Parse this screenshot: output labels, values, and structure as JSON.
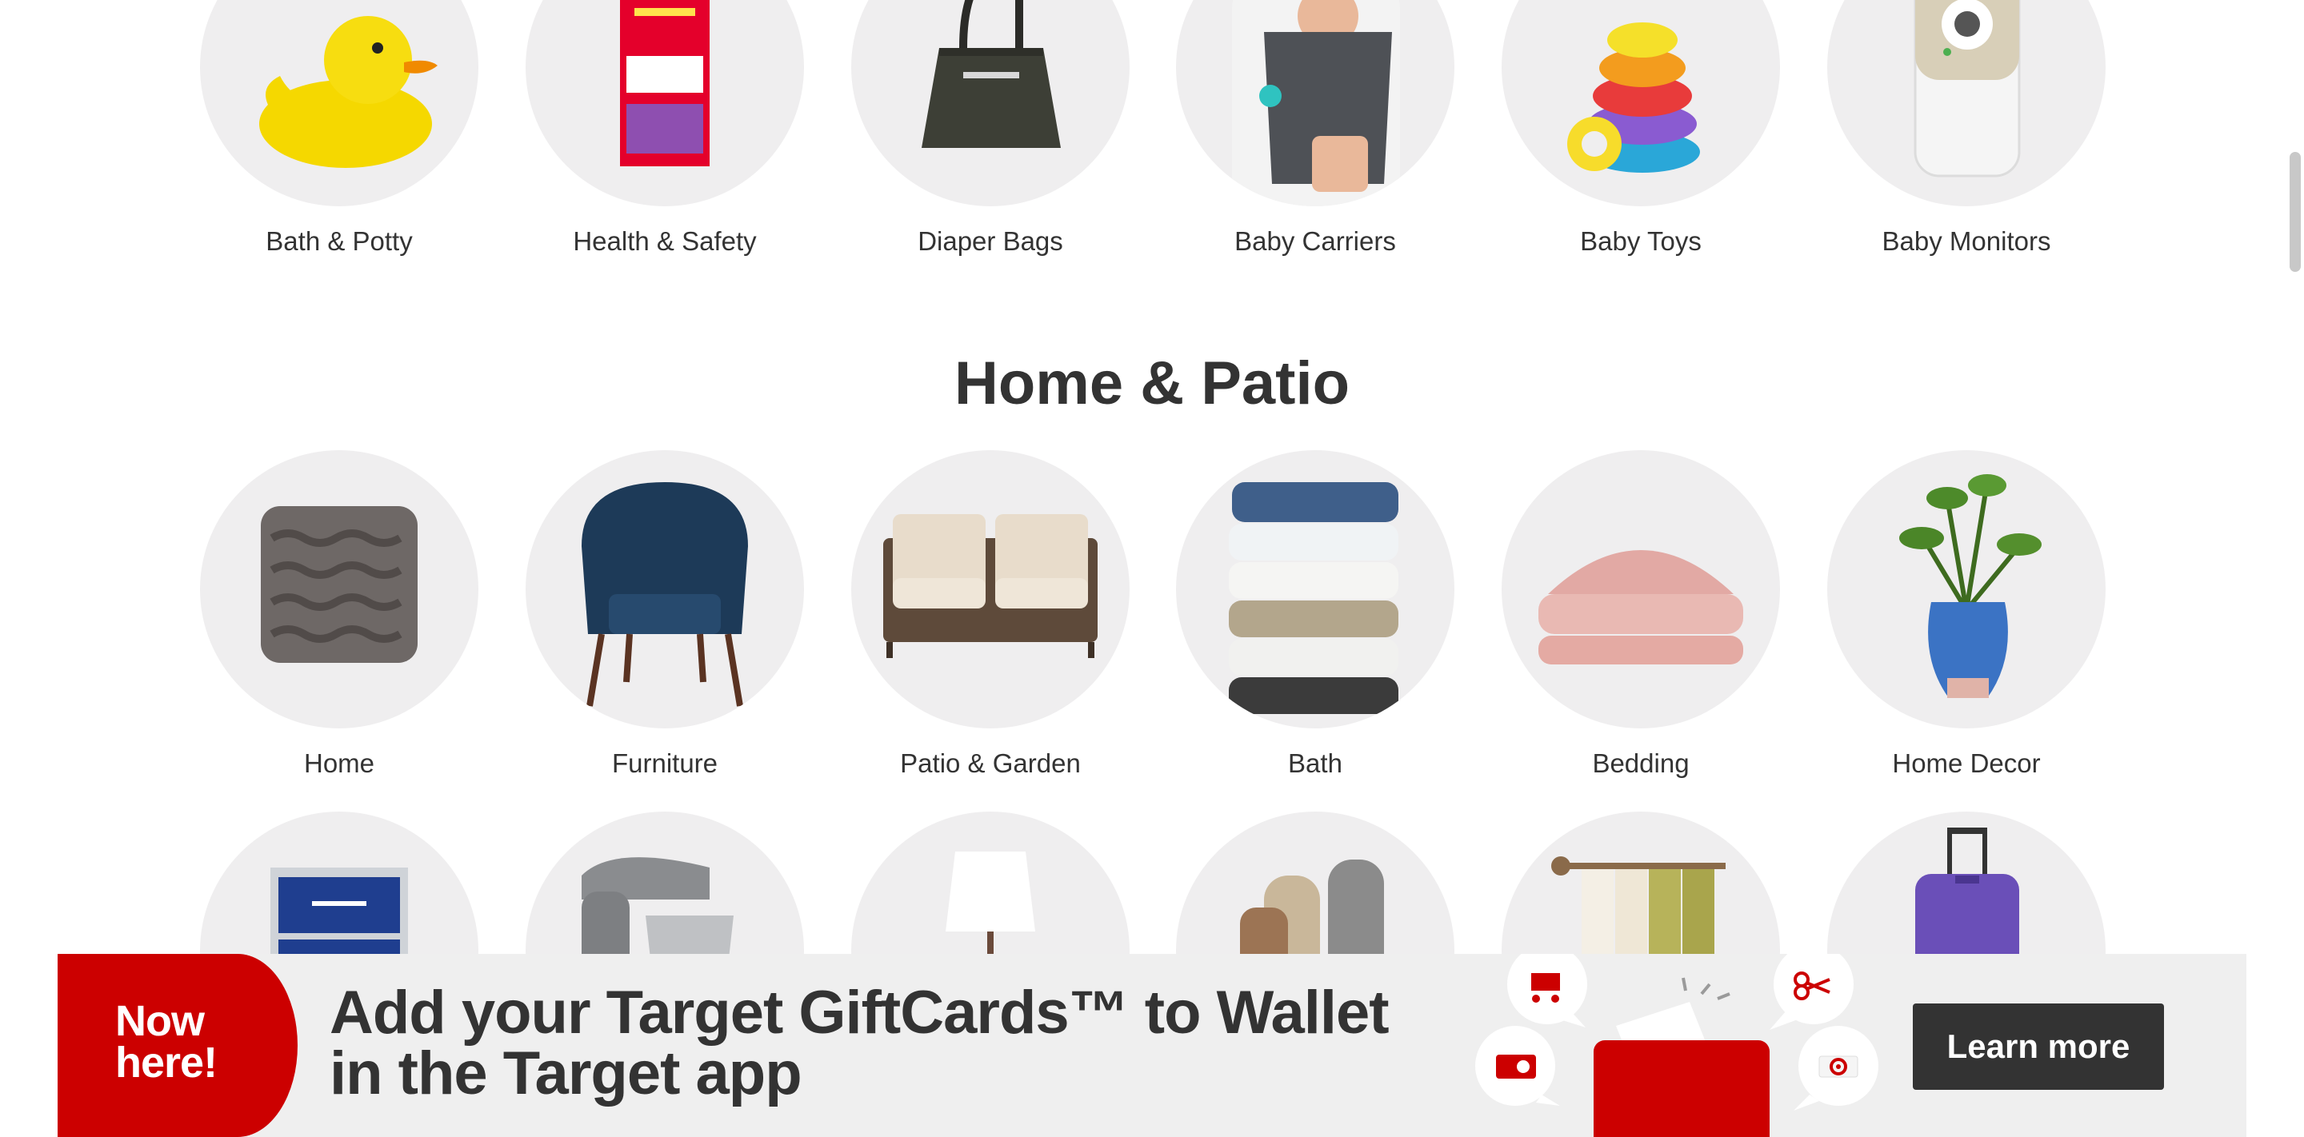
{
  "sections": [
    {
      "title": "",
      "categories": [
        {
          "label": "Bath & Potty",
          "icon": "rubber-duck-icon"
        },
        {
          "label": "Health & Safety",
          "icon": "medicine-box-icon"
        },
        {
          "label": "Diaper Bags",
          "icon": "diaper-bag-icon"
        },
        {
          "label": "Baby Carriers",
          "icon": "baby-carrier-icon"
        },
        {
          "label": "Baby Toys",
          "icon": "stacking-rings-icon"
        },
        {
          "label": "Baby Monitors",
          "icon": "baby-monitor-icon"
        }
      ]
    },
    {
      "title": "Home & Patio",
      "categories": [
        {
          "label": "Home",
          "icon": "pillow-icon"
        },
        {
          "label": "Furniture",
          "icon": "armchair-icon"
        },
        {
          "label": "Patio & Garden",
          "icon": "patio-loveseat-icon"
        },
        {
          "label": "Bath",
          "icon": "towel-stack-icon"
        },
        {
          "label": "Bedding",
          "icon": "bedding-icon"
        },
        {
          "label": "Home Decor",
          "icon": "plant-pot-icon"
        },
        {
          "label": "",
          "icon": "storage-drawers-icon"
        },
        {
          "label": "",
          "icon": "stand-mixer-icon"
        },
        {
          "label": "",
          "icon": "table-lamp-icon"
        },
        {
          "label": "",
          "icon": "rugs-and-vases-icon"
        },
        {
          "label": "",
          "icon": "curtains-icon"
        },
        {
          "label": "",
          "icon": "suitcase-icon"
        }
      ]
    }
  ],
  "banner": {
    "badge_line1": "Now",
    "badge_line2": "here!",
    "headline_line1": "Add your Target GiftCards™ to Wallet",
    "headline_line2": "in the Target app",
    "cta": "Learn more",
    "art_icons": [
      "cart-bubble-icon",
      "scissors-bubble-icon",
      "giftcard-bubble-icon",
      "target-bubble-icon",
      "wallet-icon"
    ]
  },
  "colors": {
    "brand_red": "#cc0000",
    "text": "#333333",
    "circle_bg": "#efeeef",
    "banner_bg": "#efefef",
    "button_bg": "#333333"
  }
}
